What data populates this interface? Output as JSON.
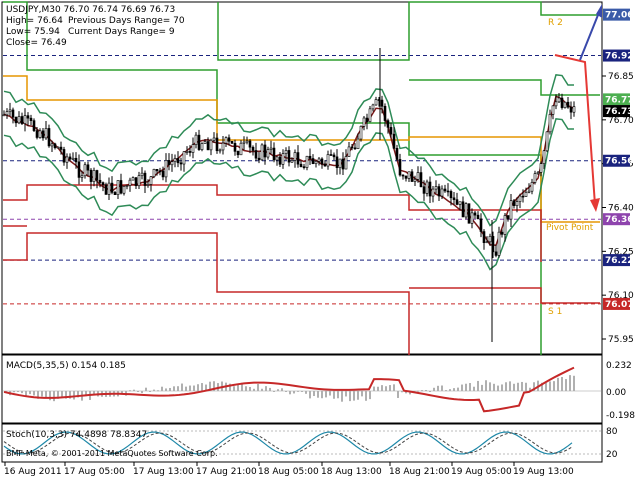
{
  "window": {
    "header_lines": [
      "USDJPY,M30  76.70 76.74 76.69 76.73",
      "High= 76.64",
      "Low= 75.94",
      "Close= 76.49"
    ],
    "header_extra": [
      "Previous Days Range= 70",
      "Current Days Range= 9"
    ],
    "copyright": "BMF-Meta, © 2001-2011 MetaQuotes Software Corp."
  },
  "price_axis": {
    "ticks": [
      "76.85",
      "76.70",
      "76.55",
      "76.40",
      "76.25",
      "76.10",
      "75.95"
    ],
    "level_labels": [
      {
        "text": "77.06",
        "color": "#3b5ba8"
      },
      {
        "text": "76.92",
        "color": "#1a237e"
      },
      {
        "text": "76.77",
        "color": "#4caf50"
      },
      {
        "text": "76.73",
        "color": "#000000"
      },
      {
        "text": "76.56",
        "color": "#1a237e"
      },
      {
        "text": "76.36",
        "color": "#8e44ad"
      },
      {
        "text": "76.22",
        "color": "#1a237e"
      },
      {
        "text": "76.07",
        "color": "#c62828"
      }
    ]
  },
  "annotations": {
    "r2": "R 2",
    "pivot": "Pivot Point",
    "s1": "S 1"
  },
  "macd": {
    "title": "MACD(5,35,5) 0.154 0.185",
    "ticks": [
      "0.232",
      "0.00",
      "-0.198"
    ]
  },
  "stoch": {
    "title": "Stoch(10,3,3) 74.4898 78.8347",
    "ticks": [
      "80",
      "20"
    ]
  },
  "time_axis": {
    "labels": [
      "16 Aug 2011",
      "17 Aug 05:00",
      "17 Aug 13:00",
      "17 Aug 21:00",
      "18 Aug 05:00",
      "18 Aug 13:00",
      "18 Aug 21:00",
      "19 Aug 05:00",
      "19 Aug 13:00"
    ]
  }
}
